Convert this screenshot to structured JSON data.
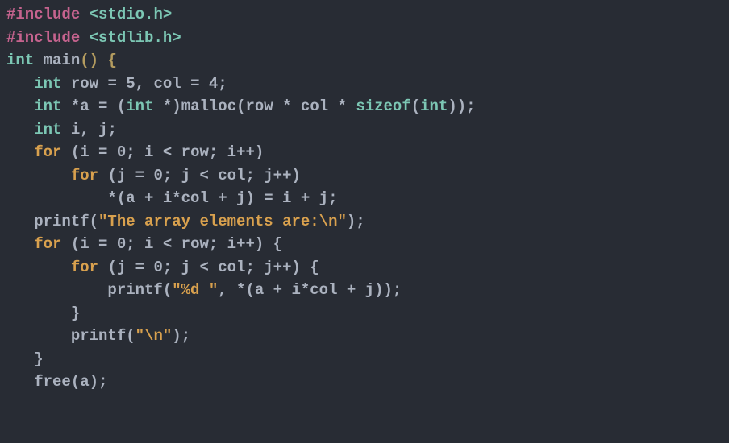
{
  "code": {
    "line1": {
      "include": "#include ",
      "header": "<stdio.h>"
    },
    "line2": {
      "include": "#include ",
      "header": "<stdlib.h>"
    },
    "line3": {
      "type": "int",
      "func": " main",
      "rest1": "()",
      "rest2": " {"
    },
    "line4": {
      "indent": "   ",
      "type": "int",
      "rest": " row = 5, col = 4;"
    },
    "line5": {
      "indent": "   ",
      "type1": "int",
      "star": " *a = (",
      "type2": "int",
      "star2": " *)malloc(row * col * ",
      "sizeof": "sizeof",
      "paren": "(",
      "type3": "int",
      "close": "));"
    },
    "line6": {
      "indent": "   ",
      "type": "int",
      "rest": " i, j;"
    },
    "line7": {
      "indent": "   ",
      "kw": "for",
      "rest": " (i = 0; i < row; i++)"
    },
    "line8": {
      "indent": "       ",
      "kw": "for",
      "rest": " (j = 0; j < col; j++)"
    },
    "line9": {
      "indent": "           *(a + i*col + j) = i + j;"
    },
    "line10": {
      "indent": "   printf(",
      "str": "\"The array elements are:\\n\"",
      "rest": ");"
    },
    "line11": {
      "indent": "   ",
      "kw": "for",
      "rest": " (i = 0; i < row; i++) {"
    },
    "line12": {
      "indent": "       ",
      "kw": "for",
      "rest": " (j = 0; j < col; j++) {"
    },
    "line13": {
      "indent": "           printf(",
      "str": "\"%d \"",
      "rest": ", *(a + i*col + j));"
    },
    "line14": {
      "indent": "       }"
    },
    "line15": {
      "indent": "       printf(",
      "str": "\"\\n\"",
      "rest": ");"
    },
    "line16": {
      "indent": "   }"
    },
    "line17": {
      "indent": "   free(a);"
    }
  }
}
